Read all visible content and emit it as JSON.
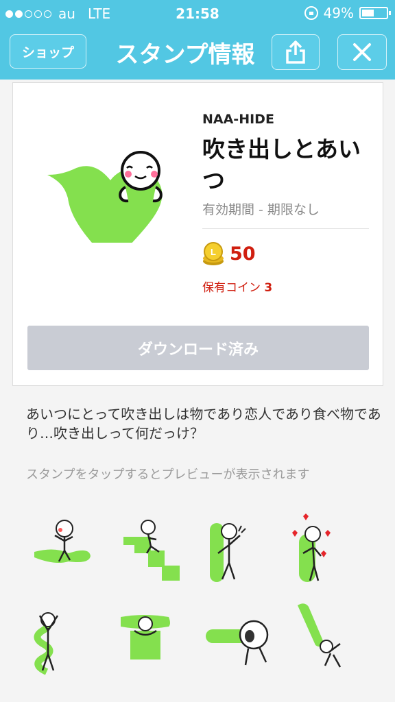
{
  "status": {
    "carrier": "au",
    "network": "LTE",
    "time": "21:58",
    "battery": "49%",
    "battery_level": 0.49
  },
  "nav": {
    "shop_label": "ショップ",
    "title": "スタンプ情報"
  },
  "product": {
    "author": "NAA-HIDE",
    "title": "吹き出しとあいつ",
    "validity": "有効期間 - 期限なし",
    "price": "50",
    "owned_label": "保有コイン",
    "owned_count": "3",
    "download_label": "ダウンロード済み"
  },
  "description": "あいつにとって吹き出しは物であり恋人であり食べ物であり…吹き出しって何だっけ？",
  "preview_hint": "スタンプをタップするとプレビューが表示されます",
  "colors": {
    "header": "#52c7e3",
    "sticker_green": "#84e04e",
    "price_red": "#d01f10"
  }
}
